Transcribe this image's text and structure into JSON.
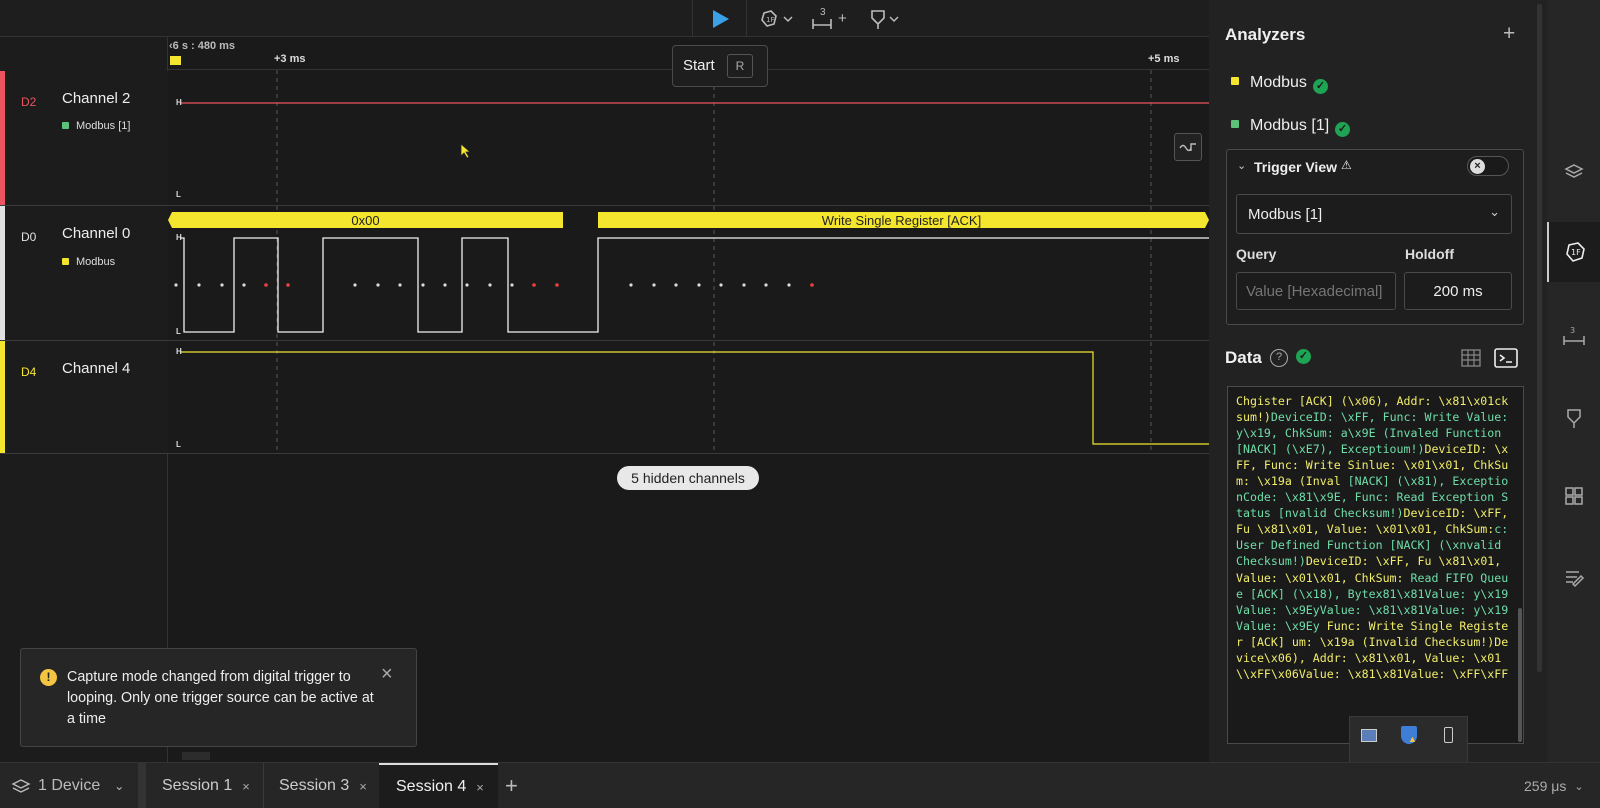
{
  "toolbar": {
    "tooltip_label": "Start",
    "tooltip_key": "R",
    "trigger_count": "3"
  },
  "timeline": {
    "start_label": "6 s : 480 ms",
    "marker_3ms": "+3 ms",
    "marker_5ms": "+5 ms"
  },
  "channels": [
    {
      "code": "D2",
      "name": "Channel 2",
      "sub": "Modbus [1]",
      "color": "#e9545e",
      "sub_color": "#5cc27a"
    },
    {
      "code": "D0",
      "name": "Channel 0",
      "sub": "Modbus",
      "color": "#e0e0e0",
      "sub_color": "#f4e62e"
    },
    {
      "code": "D4",
      "name": "Channel 4",
      "sub": "",
      "color": "#f4e62e"
    }
  ],
  "levels": {
    "high": "H",
    "low": "L"
  },
  "decode_frames": [
    {
      "label": "0x00"
    },
    {
      "label": "Write Single Register [ACK]"
    }
  ],
  "hidden_channels": "5 hidden channels",
  "notification": {
    "text": "Capture mode changed from digital trigger to looping. Only one trigger source can be active at a time",
    "close": "×"
  },
  "analyzers": {
    "title": "Analyzers",
    "add": "+",
    "items": [
      {
        "label": "Modbus",
        "color": "#f4e62e"
      },
      {
        "label": "Modbus [1]",
        "color": "#5cc27a"
      }
    ],
    "check_glyph": "✓"
  },
  "trigger_view": {
    "title": "Trigger View",
    "warn": "⚠",
    "analyzer_select": "Modbus [1]",
    "query_label": "Query",
    "query_placeholder": "Value [Hexadecimal]",
    "holdoff_label": "Holdoff",
    "holdoff_value": "200 ms"
  },
  "data_section": {
    "title": "Data",
    "help": "?",
    "terminal_segments": [
      {
        "text": "Chgister [ACK] (\\x06), Addr: \\x81\\x01cksum!)",
        "c": "y"
      },
      {
        "text": "DeviceID: \\xFF, Func: Write  Value: y\\x19, ChkSum: a\\x9E (Invaled Function [NACK] (\\xE7), Exceptioum!)",
        "c": "g"
      },
      {
        "text": "DeviceID: \\xFF, Func: Write Sinlue: \\x01\\x01, ChkSum: \\x19a (Inval",
        "c": "y"
      },
      {
        "text": " [NACK] (\\x81), ExceptionCode: \\x81\\x9E, Func: Read Exception Status [nvalid Checksum!)",
        "c": "g"
      },
      {
        "text": "DeviceID: \\xFF, Fu \\x81\\x01, Value: \\x01\\x01, ChkSum:",
        "c": "y"
      },
      {
        "text": "c: User Defined Function [NACK] (\\xnvalid Checksum!)",
        "c": "g"
      },
      {
        "text": "DeviceID: \\xFF, Fu \\x81\\x01, Value: \\x01\\x01, ChkSum:",
        "c": "y"
      },
      {
        "text": " Read FIFO Queue [ACK] (\\x18), Bytex81\\x81Value: y\\x19Value: \\x9EyValue: \\x81\\x81Value: y\\x19Value: \\x9Ey",
        "c": "g"
      },
      {
        "text": " Func: Write Single Register [ACK] um: \\x19a (Invalid Checksum!)Device\\x06), Addr: \\x81\\x01, Value: \\x01\\\\xFF\\x06Value: \\x81\\x81Value: \\xFF\\xFF",
        "c": "y"
      }
    ]
  },
  "bottom": {
    "device": "1 Device",
    "tabs": [
      {
        "label": "Session 1",
        "close": "×"
      },
      {
        "label": "Session 3",
        "close": "×"
      },
      {
        "label": "Session 4",
        "close": "×"
      }
    ],
    "add_tab": "+",
    "timing": "259 μs"
  }
}
